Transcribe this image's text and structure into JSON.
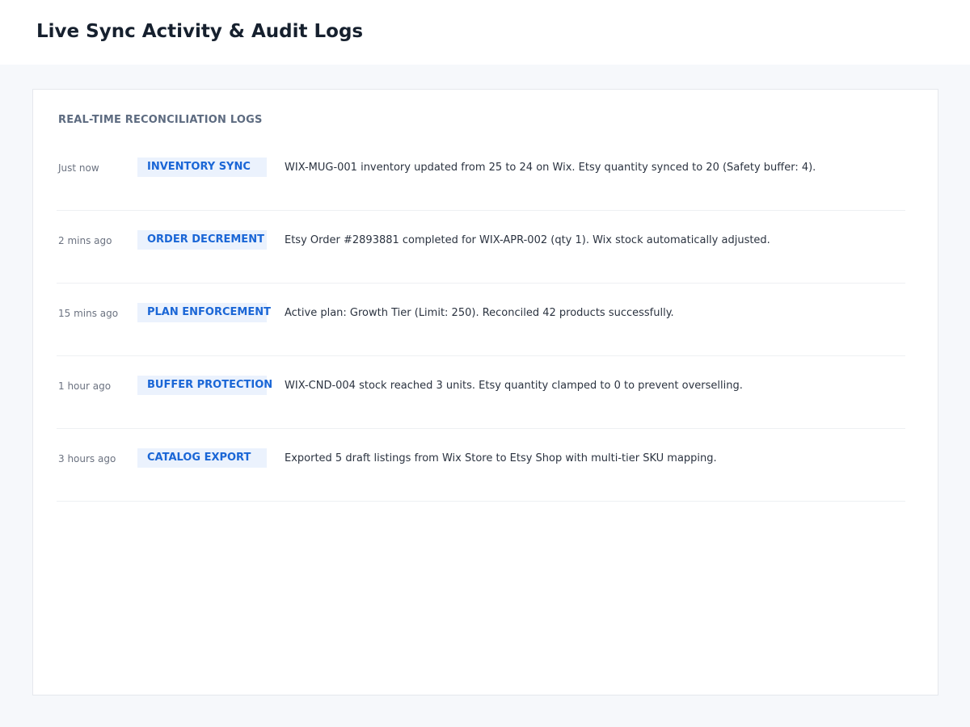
{
  "header": {
    "title": "Live Sync Activity & Audit Logs"
  },
  "logs_panel": {
    "section_label": "REAL-TIME RECONCILIATION LOGS",
    "entries": [
      {
        "time": "Just now",
        "badge": "INVENTORY SYNC",
        "message": "WIX-MUG-001 inventory updated from 25 to 24 on Wix. Etsy quantity synced to 20 (Safety buffer: 4)."
      },
      {
        "time": "2 mins ago",
        "badge": "ORDER DECREMENT",
        "message": "Etsy Order #2893881 completed for WIX-APR-002 (qty 1). Wix stock automatically adjusted."
      },
      {
        "time": "15 mins ago",
        "badge": "PLAN ENFORCEMENT",
        "message": "Active plan: Growth Tier (Limit: 250). Reconciled 42 products successfully."
      },
      {
        "time": "1 hour ago",
        "badge": "BUFFER PROTECTION",
        "message": "WIX-CND-004 stock reached 3 units. Etsy quantity clamped to 0 to prevent overselling."
      },
      {
        "time": "3 hours ago",
        "badge": "CATALOG EXPORT",
        "message": "Exported 5 draft listings from Wix Store to Etsy Shop with multi-tier SKU mapping."
      }
    ]
  },
  "colors": {
    "page_background": "#f6f8fb",
    "badge_background": "#ebf2fd",
    "badge_text": "#1a66d6",
    "title_text": "#16202e"
  }
}
